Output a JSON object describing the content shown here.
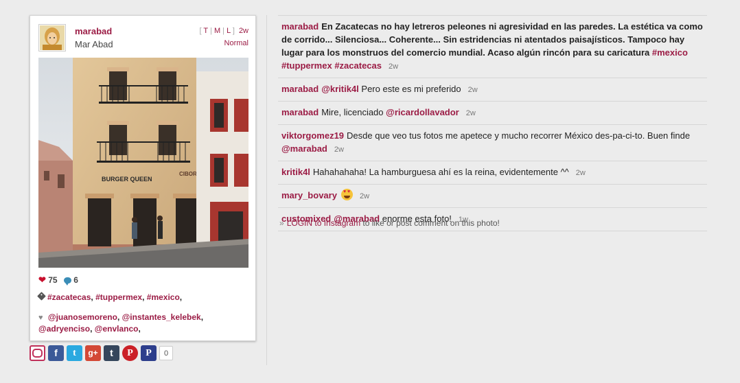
{
  "post": {
    "username": "marabad",
    "full_name": "Mar Abad",
    "size_links": [
      "T",
      "M",
      "L"
    ],
    "age": "2w",
    "filter": "Normal",
    "likes": "75",
    "comments_count": "6",
    "tags": [
      "#zacatecas",
      "#tuppermex",
      "#mexico"
    ],
    "likers": [
      "@juanosemoreno",
      "@instantes_kelebek",
      "@adryenciso",
      "@envlanco"
    ],
    "photo_text": {
      "sign_left": "BURGER QUEEN",
      "sign_right": "CIBOR"
    }
  },
  "share": {
    "count": "0",
    "buttons": [
      "instagram-share-icon",
      "facebook-icon",
      "twitter-icon",
      "google-plus-icon",
      "tumblr-icon",
      "pinterest-icon",
      "pinterest-alt-icon"
    ],
    "labels": {
      "fb": "f",
      "tw": "t",
      "gp": "g+",
      "tu": "t",
      "pi": "P",
      "pi2": "P"
    }
  },
  "comments": [
    {
      "user": "marabad",
      "pre": "En Zacatecas no hay letreros peleones ni agresividad en las paredes. La estética va como de corrido... Silenciosa... Coherente... Sin estridencias ni atentados paisajísticos. Tampoco hay lugar para los monstruos del comercio mundial. Acaso algún rincón para su caricatura ",
      "tags": [
        "#mexico",
        "#tuppermex",
        "#zacatecas"
      ],
      "time": "2w"
    },
    {
      "user": "marabad",
      "mention": "@kritik4l",
      "post": " Pero este es mi preferido",
      "time": "2w"
    },
    {
      "user": "marabad",
      "pre": "Mire, licenciado ",
      "mention": "@ricardollavador",
      "time": "2w"
    },
    {
      "user": "viktorgomez19",
      "pre": "Desde que veo tus fotos me apetece y mucho recorrer México des-pa-ci-to. Buen finde ",
      "mention": "@marabad",
      "time": "2w"
    },
    {
      "user": "kritik4l",
      "pre": "Hahahahaha! La hamburguesa ahí es la reina, evidentemente ^^",
      "time": "2w"
    },
    {
      "user": "mary_bovary",
      "time": "2w"
    },
    {
      "user": "customixed",
      "mention": "@marabad",
      "post": " enorme esta foto!",
      "time": "1w"
    }
  ],
  "login": {
    "link": "LOGIN to Instagram",
    "rest": " to like or post comment on this photo!"
  },
  "colors": {
    "accent": "#9b1c45",
    "background": "#ececec"
  }
}
